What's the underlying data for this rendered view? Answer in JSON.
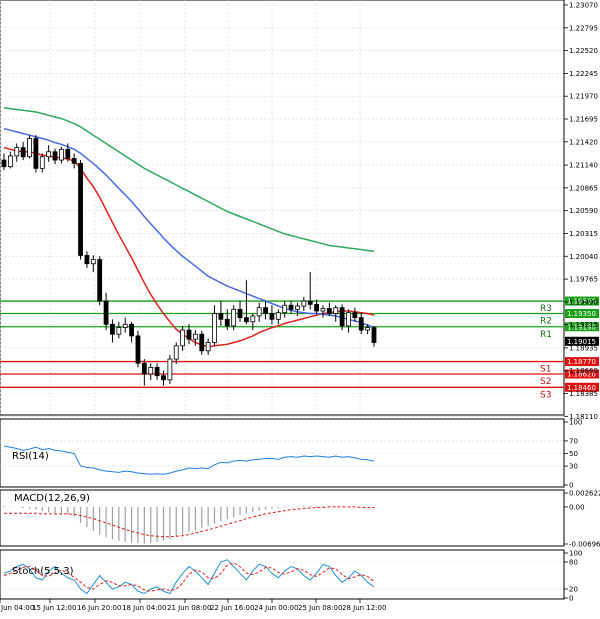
{
  "chart_data": [
    {
      "type": "candlestick",
      "title": "",
      "ylim": [
        1.1815,
        1.2307
      ],
      "y_ticks": [
        "1.23070",
        "1.22795",
        "1.22520",
        "1.22245",
        "1.21970",
        "1.21695",
        "1.21420",
        "1.21140",
        "1.20865",
        "1.20590",
        "1.20315",
        "1.20040",
        "1.19765",
        "1.19490",
        "1.19215",
        "1.18935",
        "1.18660",
        "1.18385",
        "1.18110"
      ],
      "x_ticks": [
        "Jun 04:00",
        "15 Jun 12:00",
        "16 Jun 20:00",
        "18 Jun 04:00",
        "21 Jun 08:00",
        "22 Jun 16:00",
        "24 Jun 00:00",
        "25 Jun 08:00",
        "28 Jun 12:00"
      ],
      "last_price": "1.19015",
      "levels": [
        {
          "name": "R3",
          "value": 1.195,
          "tag": "1.19500",
          "color": "#19a019"
        },
        {
          "name": "R2",
          "value": 1.1935,
          "tag": "1.19350",
          "color": "#19a019"
        },
        {
          "name": "R1",
          "value": 1.1919,
          "tag": "1.19190",
          "color": "#19a019"
        },
        {
          "name": "S1",
          "value": 1.1877,
          "tag": "1.18770",
          "color": "#e01010"
        },
        {
          "name": "S2",
          "value": 1.1862,
          "tag": "1.18620",
          "color": "#e01010"
        },
        {
          "name": "S3",
          "value": 1.1846,
          "tag": "1.18460",
          "color": "#e01010"
        }
      ],
      "candles": [
        [
          1.212,
          1.2128,
          1.2108,
          1.2112
        ],
        [
          1.2112,
          1.213,
          1.211,
          1.2125
        ],
        [
          1.2125,
          1.214,
          1.2118,
          1.2135
        ],
        [
          1.2135,
          1.2142,
          1.212,
          1.2124
        ],
        [
          1.2124,
          1.215,
          1.2122,
          1.2146
        ],
        [
          1.2146,
          1.215,
          1.2105,
          1.211
        ],
        [
          1.211,
          1.2128,
          1.2105,
          1.2124
        ],
        [
          1.2124,
          1.2138,
          1.2118,
          1.213
        ],
        [
          1.213,
          1.2134,
          1.2115,
          1.212
        ],
        [
          1.212,
          1.2136,
          1.2116,
          1.2133
        ],
        [
          1.2133,
          1.214,
          1.2118,
          1.2122
        ],
        [
          1.2122,
          1.2128,
          1.211,
          1.2116
        ],
        [
          1.2116,
          1.212,
          1.2,
          1.2005
        ],
        [
          1.2005,
          1.201,
          1.199,
          1.1995
        ],
        [
          1.1995,
          1.2005,
          1.1985,
          1.2
        ],
        [
          1.2,
          1.2004,
          1.1945,
          1.195
        ],
        [
          1.195,
          1.196,
          1.1915,
          1.1922
        ],
        [
          1.1922,
          1.1928,
          1.19,
          1.191
        ],
        [
          1.191,
          1.1925,
          1.1905,
          1.1918
        ],
        [
          1.1918,
          1.193,
          1.1912,
          1.1922
        ],
        [
          1.1922,
          1.1925,
          1.19,
          1.1908
        ],
        [
          1.1908,
          1.1914,
          1.187,
          1.1875
        ],
        [
          1.1875,
          1.188,
          1.1848,
          1.1862
        ],
        [
          1.1862,
          1.1875,
          1.1855,
          1.187
        ],
        [
          1.187,
          1.1875,
          1.1855,
          1.186
        ],
        [
          1.186,
          1.1866,
          1.1848,
          1.1855
        ],
        [
          1.1855,
          1.1885,
          1.185,
          1.188
        ],
        [
          1.188,
          1.19,
          1.1874,
          1.1896
        ],
        [
          1.1896,
          1.192,
          1.189,
          1.1915
        ],
        [
          1.1915,
          1.1922,
          1.1898,
          1.1904
        ],
        [
          1.1904,
          1.1915,
          1.1896,
          1.191
        ],
        [
          1.191,
          1.1914,
          1.1885,
          1.189
        ],
        [
          1.189,
          1.1905,
          1.1885,
          1.19
        ],
        [
          1.19,
          1.1945,
          1.1895,
          1.1935
        ],
        [
          1.1935,
          1.195,
          1.192,
          1.1928
        ],
        [
          1.1928,
          1.194,
          1.1915,
          1.192
        ],
        [
          1.192,
          1.1945,
          1.1915,
          1.194
        ],
        [
          1.194,
          1.195,
          1.1925,
          1.193
        ],
        [
          1.193,
          1.1975,
          1.1922,
          1.1925
        ],
        [
          1.1925,
          1.1935,
          1.1915,
          1.1932
        ],
        [
          1.1932,
          1.1948,
          1.1925,
          1.1942
        ],
        [
          1.1942,
          1.195,
          1.1928,
          1.1935
        ],
        [
          1.1935,
          1.1945,
          1.1922,
          1.1928
        ],
        [
          1.1928,
          1.194,
          1.1922,
          1.1936
        ],
        [
          1.1936,
          1.195,
          1.193,
          1.1945
        ],
        [
          1.1945,
          1.195,
          1.1935,
          1.194
        ],
        [
          1.194,
          1.1948,
          1.1932,
          1.1944
        ],
        [
          1.1944,
          1.1955,
          1.1938,
          1.195
        ],
        [
          1.195,
          1.1985,
          1.194,
          1.1946
        ],
        [
          1.1946,
          1.1952,
          1.1934,
          1.1938
        ],
        [
          1.1938,
          1.1945,
          1.193,
          1.1941
        ],
        [
          1.1941,
          1.1948,
          1.1932,
          1.1935
        ],
        [
          1.1935,
          1.1945,
          1.1925,
          1.1942
        ],
        [
          1.1942,
          1.1946,
          1.1915,
          1.192
        ],
        [
          1.192,
          1.194,
          1.1912,
          1.1936
        ],
        [
          1.1936,
          1.1942,
          1.1925,
          1.193
        ],
        [
          1.193,
          1.1936,
          1.191,
          1.1915
        ],
        [
          1.1915,
          1.1922,
          1.191,
          1.1918
        ],
        [
          1.1918,
          1.192,
          1.1895,
          1.19
        ]
      ],
      "ma": [
        {
          "color": "#e02020",
          "values": [
            1.2135,
            1.2133,
            1.2131,
            1.213,
            1.213,
            1.2128,
            1.2126,
            1.2125,
            1.2123,
            1.2123,
            1.2121,
            1.2119,
            1.211,
            1.2098,
            1.2088,
            1.2075,
            1.206,
            1.2045,
            1.203,
            1.2016,
            1.2002,
            1.1987,
            1.1972,
            1.1958,
            1.1946,
            1.1935,
            1.1925,
            1.1916,
            1.191,
            1.1905,
            1.19,
            1.1897,
            1.1895,
            1.1896,
            1.1897,
            1.1898,
            1.19,
            1.1902,
            1.1905,
            1.1908,
            1.1912,
            1.1915,
            1.1918,
            1.192,
            1.1923,
            1.1925,
            1.1927,
            1.1929,
            1.1931,
            1.1933,
            1.1935,
            1.1936,
            1.1937,
            1.1938,
            1.1938,
            1.1937,
            1.1936,
            1.1935,
            1.1933
          ]
        },
        {
          "color": "#4a6be0",
          "values": [
            1.2158,
            1.2156,
            1.2154,
            1.2152,
            1.215,
            1.2148,
            1.2146,
            1.2144,
            1.2141,
            1.2139,
            1.2136,
            1.2133,
            1.2128,
            1.2122,
            1.2116,
            1.2109,
            1.2102,
            1.2094,
            1.2086,
            1.2078,
            1.207,
            1.2061,
            1.2052,
            1.2043,
            1.2035,
            1.2026,
            1.2018,
            1.2011,
            1.2004,
            1.1998,
            1.1992,
            1.1986,
            1.198,
            1.1976,
            1.1972,
            1.1968,
            1.1965,
            1.1962,
            1.1959,
            1.1956,
            1.1953,
            1.195,
            1.1947,
            1.1944,
            1.1941,
            1.1939,
            1.1937,
            1.1936,
            1.1935,
            1.1935,
            1.1934,
            1.1933,
            1.1932,
            1.193,
            1.1928,
            1.1926,
            1.1924,
            1.1921,
            1.1918
          ]
        },
        {
          "color": "#30a860",
          "values": [
            1.2183,
            1.2182,
            1.2181,
            1.218,
            1.2179,
            1.2178,
            1.2176,
            1.2174,
            1.2172,
            1.217,
            1.2167,
            1.2164,
            1.216,
            1.2155,
            1.215,
            1.2145,
            1.214,
            1.2135,
            1.213,
            1.2125,
            1.212,
            1.2115,
            1.211,
            1.2106,
            1.2102,
            1.2098,
            1.2094,
            1.209,
            1.2086,
            1.2082,
            1.2078,
            1.2074,
            1.207,
            1.2066,
            1.2062,
            1.2058,
            1.2055,
            1.2052,
            1.2049,
            1.2046,
            1.2043,
            1.204,
            1.2037,
            1.2034,
            1.2031,
            1.2029,
            1.2027,
            1.2025,
            1.2023,
            1.2021,
            1.2019,
            1.2017,
            1.2016,
            1.2015,
            1.2014,
            1.2013,
            1.2012,
            1.2011,
            1.201
          ]
        }
      ]
    },
    {
      "type": "line",
      "name": "RSI(14)",
      "ylim": [
        0,
        100
      ],
      "y_ticks": [
        "100",
        "70",
        "50",
        "30",
        "0"
      ],
      "values": [
        62,
        60,
        58,
        55,
        57,
        60,
        56,
        58,
        55,
        54,
        52,
        50,
        30,
        28,
        27,
        24,
        22,
        21,
        20,
        22,
        21,
        19,
        18,
        17,
        18,
        17,
        19,
        22,
        24,
        27,
        26,
        27,
        26,
        32,
        36,
        35,
        38,
        39,
        38,
        40,
        41,
        42,
        42,
        41,
        44,
        45,
        44,
        46,
        45,
        46,
        45,
        44,
        46,
        44,
        45,
        43,
        41,
        40,
        38
      ]
    },
    {
      "type": "bar",
      "name": "MACD(12,26,9)",
      "ylim": [
        -0.006966,
        0.002622
      ],
      "y_ticks": [
        "0.002622",
        "0.00",
        "-0.006966"
      ],
      "histogram": [
        0.0002,
        0.0001,
        0.0,
        -0.0002,
        -0.0003,
        -0.0005,
        -0.0008,
        -0.001,
        -0.0012,
        -0.0013,
        -0.0015,
        -0.0018,
        -0.003,
        -0.0038,
        -0.0045,
        -0.0052,
        -0.0057,
        -0.0061,
        -0.0064,
        -0.0066,
        -0.0067,
        -0.0068,
        -0.0069,
        -0.0068,
        -0.0066,
        -0.0063,
        -0.006,
        -0.0056,
        -0.0052,
        -0.0048,
        -0.0044,
        -0.004,
        -0.0036,
        -0.0031,
        -0.0027,
        -0.0023,
        -0.0019,
        -0.0015,
        -0.0012,
        -0.0009,
        -0.0007,
        -0.0005,
        -0.0003,
        -0.0002,
        -0.0001,
        0.0,
        0.0001,
        0.0002,
        0.0002,
        0.0002,
        0.0002,
        0.0002,
        0.0001,
        0.0001,
        0.0,
        0.0,
        -0.0001,
        -0.0001,
        -0.0002
      ],
      "signal": [
        -0.0012,
        -0.0012,
        -0.0012,
        -0.0012,
        -0.0012,
        -0.0012,
        -0.0013,
        -0.0013,
        -0.0013,
        -0.0013,
        -0.0013,
        -0.0014,
        -0.0016,
        -0.0019,
        -0.0022,
        -0.0026,
        -0.003,
        -0.0034,
        -0.0038,
        -0.0042,
        -0.0046,
        -0.0049,
        -0.0052,
        -0.0054,
        -0.0055,
        -0.0056,
        -0.0056,
        -0.0055,
        -0.0054,
        -0.0052,
        -0.0049,
        -0.0046,
        -0.0043,
        -0.004,
        -0.0036,
        -0.0033,
        -0.0029,
        -0.0026,
        -0.0022,
        -0.0019,
        -0.0016,
        -0.0013,
        -0.0011,
        -0.0009,
        -0.0007,
        -0.0005,
        -0.0004,
        -0.0003,
        -0.0002,
        -0.0001,
        -0.0001,
        0.0,
        0.0,
        0.0,
        0.0,
        0.0,
        -0.0001,
        -0.0001,
        -0.0001
      ]
    },
    {
      "type": "line",
      "name": "Stoch(5,5,3)",
      "ylim": [
        0,
        100
      ],
      "y_ticks": [
        "100",
        "80",
        "20",
        "0"
      ],
      "k": [
        55,
        60,
        70,
        75,
        65,
        45,
        40,
        60,
        70,
        55,
        45,
        40,
        20,
        10,
        30,
        50,
        35,
        20,
        25,
        35,
        30,
        15,
        10,
        20,
        25,
        15,
        10,
        35,
        55,
        70,
        60,
        45,
        30,
        55,
        80,
        85,
        70,
        55,
        40,
        60,
        75,
        70,
        55,
        45,
        60,
        70,
        65,
        50,
        40,
        55,
        75,
        70,
        50,
        35,
        45,
        60,
        50,
        35,
        25
      ],
      "d": [
        50,
        55,
        62,
        68,
        70,
        62,
        50,
        48,
        56,
        62,
        56,
        46,
        35,
        23,
        20,
        30,
        38,
        35,
        27,
        27,
        30,
        27,
        18,
        15,
        18,
        20,
        17,
        20,
        33,
        53,
        62,
        58,
        45,
        43,
        55,
        73,
        78,
        70,
        55,
        52,
        58,
        68,
        67,
        57,
        53,
        58,
        65,
        62,
        52,
        48,
        57,
        67,
        65,
        52,
        43,
        47,
        52,
        48,
        37
      ]
    }
  ]
}
